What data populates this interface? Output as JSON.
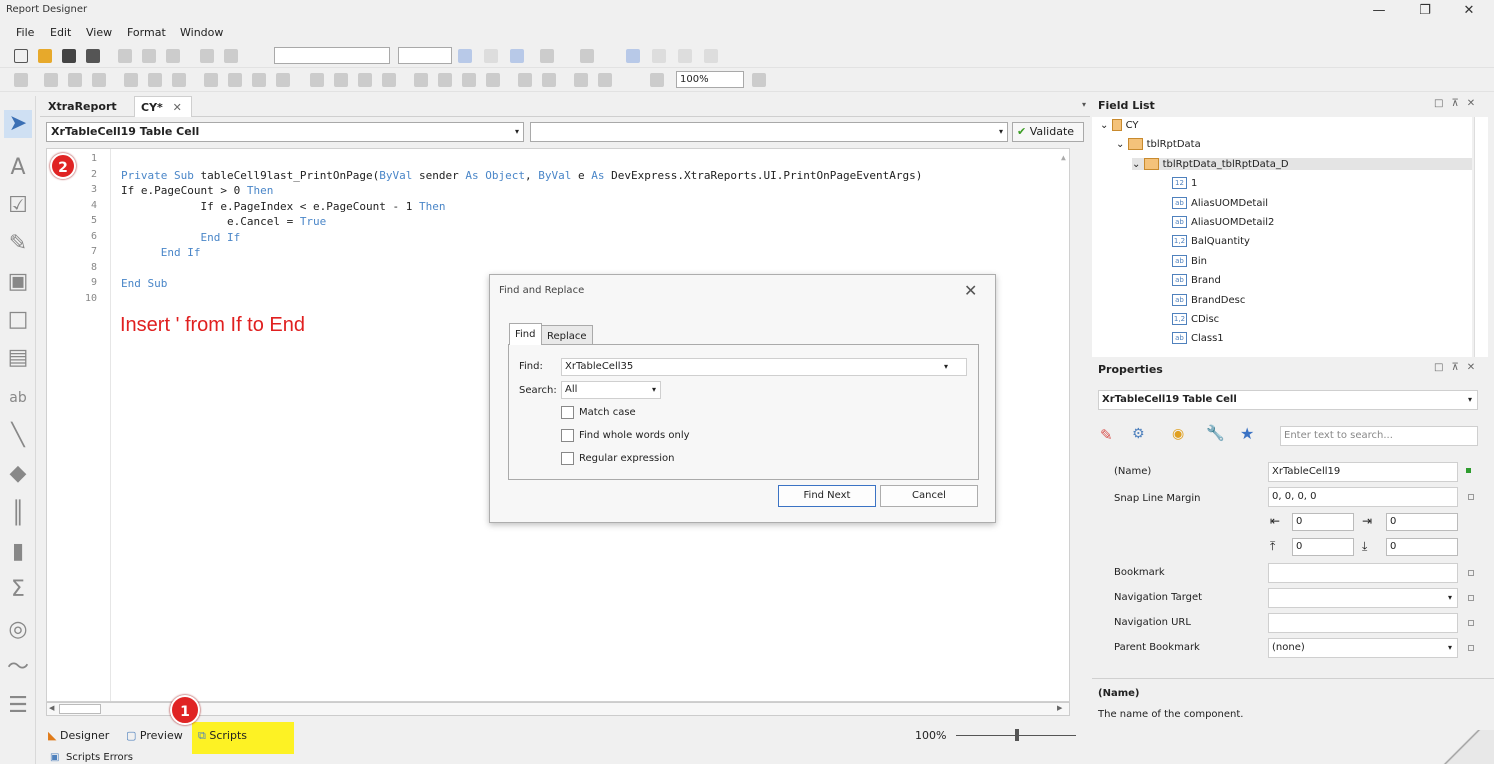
{
  "window": {
    "title": "Report Designer",
    "minimize": "—",
    "maximize": "❐",
    "close": "✕"
  },
  "menu": [
    "File",
    "Edit",
    "View",
    "Format",
    "Window"
  ],
  "toolbar": {
    "zoom": "100%"
  },
  "tabs": [
    {
      "label": "XtraReport"
    },
    {
      "label": "CY*"
    }
  ],
  "editor": {
    "object_combo": "XrTableCell19  Table Cell",
    "event_combo": "",
    "validate_label": "Validate"
  },
  "code_lines": [
    {
      "n": "1",
      "t": ""
    },
    {
      "n": "2",
      "t": "Private Sub tableCell9last_PrintOnPage(ByVal sender As Object, ByVal e As DevExpress.XtraReports.UI.PrintOnPageEventArgs)"
    },
    {
      "n": "3",
      "t": "If e.PageCount > 0 Then"
    },
    {
      "n": "4",
      "t": "            If e.PageIndex < e.PageCount - 1 Then"
    },
    {
      "n": "5",
      "t": "                e.Cancel = True"
    },
    {
      "n": "6",
      "t": "            End If"
    },
    {
      "n": "7",
      "t": "      End If"
    },
    {
      "n": "8",
      "t": ""
    },
    {
      "n": "9",
      "t": "End Sub"
    },
    {
      "n": "10",
      "t": ""
    }
  ],
  "annotation": {
    "note": "Insert ' from If to End",
    "badge1": "1",
    "badge2": "2"
  },
  "find_dialog": {
    "title": "Find and Replace",
    "tab_find": "Find",
    "tab_replace": "Replace",
    "find_label": "Find:",
    "find_value": "XrTableCell35",
    "search_label": "Search:",
    "search_value": "All",
    "match_case": "Match case",
    "whole_words": "Find whole words only",
    "regex": "Regular expression",
    "find_next": "Find Next",
    "cancel": "Cancel"
  },
  "bottom_tabs": {
    "designer": "Designer",
    "preview": "Preview",
    "scripts": "Scripts",
    "zoom": "100%"
  },
  "status": {
    "scripts_errors": "Scripts Errors"
  },
  "field_list": {
    "title": "Field List",
    "nodes": [
      {
        "label": "CY",
        "level": 0,
        "icon": "db"
      },
      {
        "label": "tblRptData",
        "level": 1,
        "icon": "table"
      },
      {
        "label": "tblRptData_tblRptData_D",
        "level": 2,
        "icon": "table"
      },
      {
        "label": "1",
        "level": 3,
        "icon": "12"
      },
      {
        "label": "AliasUOMDetail",
        "level": 3,
        "icon": "ab"
      },
      {
        "label": "AliasUOMDetail2",
        "level": 3,
        "icon": "ab"
      },
      {
        "label": "BalQuantity",
        "level": 3,
        "icon": "1,2"
      },
      {
        "label": "Bin",
        "level": 3,
        "icon": "ab"
      },
      {
        "label": "Brand",
        "level": 3,
        "icon": "ab"
      },
      {
        "label": "BrandDesc",
        "level": 3,
        "icon": "ab"
      },
      {
        "label": "CDisc",
        "level": 3,
        "icon": "1,2"
      },
      {
        "label": "Class1",
        "level": 3,
        "icon": "ab"
      }
    ]
  },
  "properties": {
    "title": "Properties",
    "object": "XrTableCell19  Table Cell",
    "search_placeholder": "Enter text to search...",
    "name_label": "(Name)",
    "name_value": "XrTableCell19",
    "snap_label": "Snap Line Margin",
    "snap_value": "0, 0, 0, 0",
    "snap_left": "0",
    "snap_right": "0",
    "snap_top": "0",
    "snap_bottom": "0",
    "bookmark_label": "Bookmark",
    "navtarget_label": "Navigation Target",
    "navurl_label": "Navigation URL",
    "parentbm_label": "Parent Bookmark",
    "parentbm_value": "(none)",
    "desc_title": "(Name)",
    "desc_text": "The name of the component."
  }
}
